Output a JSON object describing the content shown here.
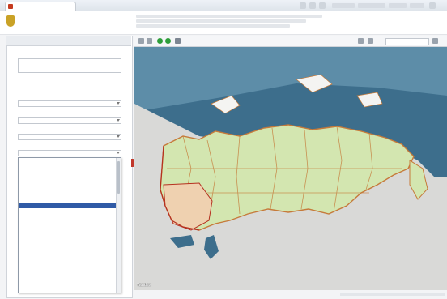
{
  "colors": {
    "brand_red": "#b11b1b",
    "russia_fill": "#d3e6b0",
    "sea": "#3d6e8c",
    "land_gray": "#d9d9d7",
    "selected_option": "#2f5aa6",
    "region_borders": "#c67a3a"
  },
  "browser": {
    "tab_title": "",
    "favicon_icon": "site-favicon-icon"
  },
  "header": {
    "site_title": "",
    "emblem_icon": "coat-of-arms-icon",
    "top_right_link": ""
  },
  "panel": {
    "heading": "",
    "search_label": "",
    "search_value": "",
    "search_placeholder": "",
    "advanced_link": "",
    "filters_heading": "",
    "filters": [
      {
        "label": "",
        "value": ""
      },
      {
        "label": "",
        "value": ""
      },
      {
        "label": "",
        "value": ""
      },
      {
        "label": "",
        "value": ""
      }
    ],
    "dropdown_options": [
      "",
      "",
      "",
      "",
      "",
      "",
      "",
      "",
      "",
      "",
      "",
      "",
      "",
      "",
      "",
      "",
      "",
      "",
      "",
      "",
      "",
      "",
      "",
      "",
      "",
      "",
      "",
      "",
      ""
    ],
    "dropdown_selected_index": 10
  },
  "map": {
    "layer_label": "",
    "toolbar_search_placeholder": "",
    "map_logo_text": "Yandex",
    "icons": [
      "zoom-in-icon",
      "zoom-out-icon",
      "play-icon",
      "layers-icon",
      "ruler-icon",
      "settings-icon"
    ]
  }
}
